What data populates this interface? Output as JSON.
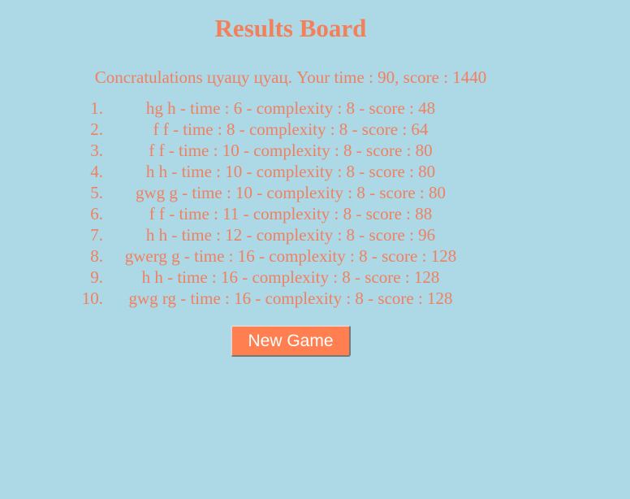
{
  "page": {
    "title": "Results Board",
    "congratulations": "Concratulations цуацу цуац. Your time : 90, score : 1440",
    "new_game_label": "New Game"
  },
  "results": [
    {
      "number": "1.",
      "text": "hg h - time : 6 - complexity : 8 - score : 48"
    },
    {
      "number": "2.",
      "text": "f f - time : 8 - complexity : 8 - score : 64"
    },
    {
      "number": "3.",
      "text": "f f - time : 10 - complexity : 8 - score : 80"
    },
    {
      "number": "4.",
      "text": "h h - time : 10 - complexity : 8 - score : 80"
    },
    {
      "number": "5.",
      "text": "gwg g - time : 10 - complexity : 8 - score : 80"
    },
    {
      "number": "6.",
      "text": "f f - time : 11 - complexity : 8 - score : 88"
    },
    {
      "number": "7.",
      "text": "h h - time : 12 - complexity : 8 - score : 96"
    },
    {
      "number": "8.",
      "text": "gwerg g - time : 16 - complexity : 8 - score : 128"
    },
    {
      "number": "9.",
      "text": "h h - time : 16 - complexity : 8 - score : 128"
    },
    {
      "number": "10.",
      "text": "gwg rg - time : 16 - complexity : 8 - score : 128"
    }
  ],
  "colors": {
    "background": "#add8e6",
    "text": "#f08060",
    "button": "#ff7f50",
    "button_text": "#ffffff"
  }
}
